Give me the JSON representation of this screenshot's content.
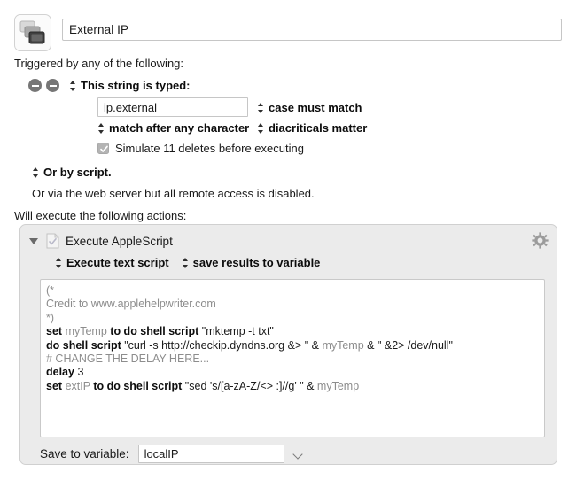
{
  "macro": {
    "icon_name": "macro-windows-icon",
    "title_value": "External IP",
    "title_placeholder": "Macro Name"
  },
  "triggers": {
    "section_label": "Triggered by any of the following:",
    "add_button_label": "+",
    "remove_button_label": "−",
    "trigger_type": "This string is typed:",
    "typed_string_value": "ip.external",
    "typed_string_placeholder": "",
    "case_option": "case must match",
    "match_option": "match after any character",
    "diacriticals_option": "diacriticals matter",
    "simulate_deletes_label": "Simulate 11 deletes before executing",
    "simulate_deletes_checked": true,
    "or_by_script": "Or by script.",
    "web_server_note": "Or via the web server but all remote access is disabled."
  },
  "actions": {
    "section_label": "Will execute the following actions:",
    "disclosure_state": "expanded",
    "action_title": "Execute AppleScript",
    "gear_icon": "gear-icon",
    "script_kind_option": "Execute text script",
    "results_option": "save results to variable",
    "script_lines": [
      [
        {
          "t": "(*",
          "c": "cmt"
        }
      ],
      [
        {
          "t": "Credit to www.applehelpwriter.com",
          "c": "cmt"
        }
      ],
      [
        {
          "t": "*)",
          "c": "cmt"
        }
      ],
      [
        {
          "t": "set",
          "c": "kw"
        },
        {
          "t": " ",
          "c": "op"
        },
        {
          "t": "myTemp",
          "c": "var"
        },
        {
          "t": " ",
          "c": "op"
        },
        {
          "t": "to do shell script",
          "c": "kw"
        },
        {
          "t": " \"mktemp -t txt\"",
          "c": "str"
        }
      ],
      [
        {
          "t": "do shell script",
          "c": "kw"
        },
        {
          "t": " \"curl -s http://checkip.dyndns.org &> \" & ",
          "c": "str"
        },
        {
          "t": "myTemp",
          "c": "var"
        },
        {
          "t": " & \" &2> /dev/null\"",
          "c": "str"
        }
      ],
      [
        {
          "t": "# CHANGE THE DELAY HERE...",
          "c": "cmt"
        }
      ],
      [
        {
          "t": "delay",
          "c": "kw"
        },
        {
          "t": " 3",
          "c": "num"
        }
      ],
      [
        {
          "t": "set",
          "c": "kw"
        },
        {
          "t": " ",
          "c": "op"
        },
        {
          "t": "extIP",
          "c": "var"
        },
        {
          "t": " ",
          "c": "op"
        },
        {
          "t": "to do shell script",
          "c": "kw"
        },
        {
          "t": " \"sed 's/[a-zA-Z/<> :]//g' \" & ",
          "c": "str"
        },
        {
          "t": "myTemp",
          "c": "var"
        }
      ]
    ],
    "save_to_variable_label": "Save to variable:",
    "save_to_variable_value": "localIP",
    "save_to_variable_placeholder": ""
  },
  "colors": {
    "panel_background": "#ebebeb",
    "field_border": "#c6c6c6",
    "text_primary": "#1a1a1a",
    "comment_gray": "#8d8d8d",
    "button_gray": "#767676"
  }
}
